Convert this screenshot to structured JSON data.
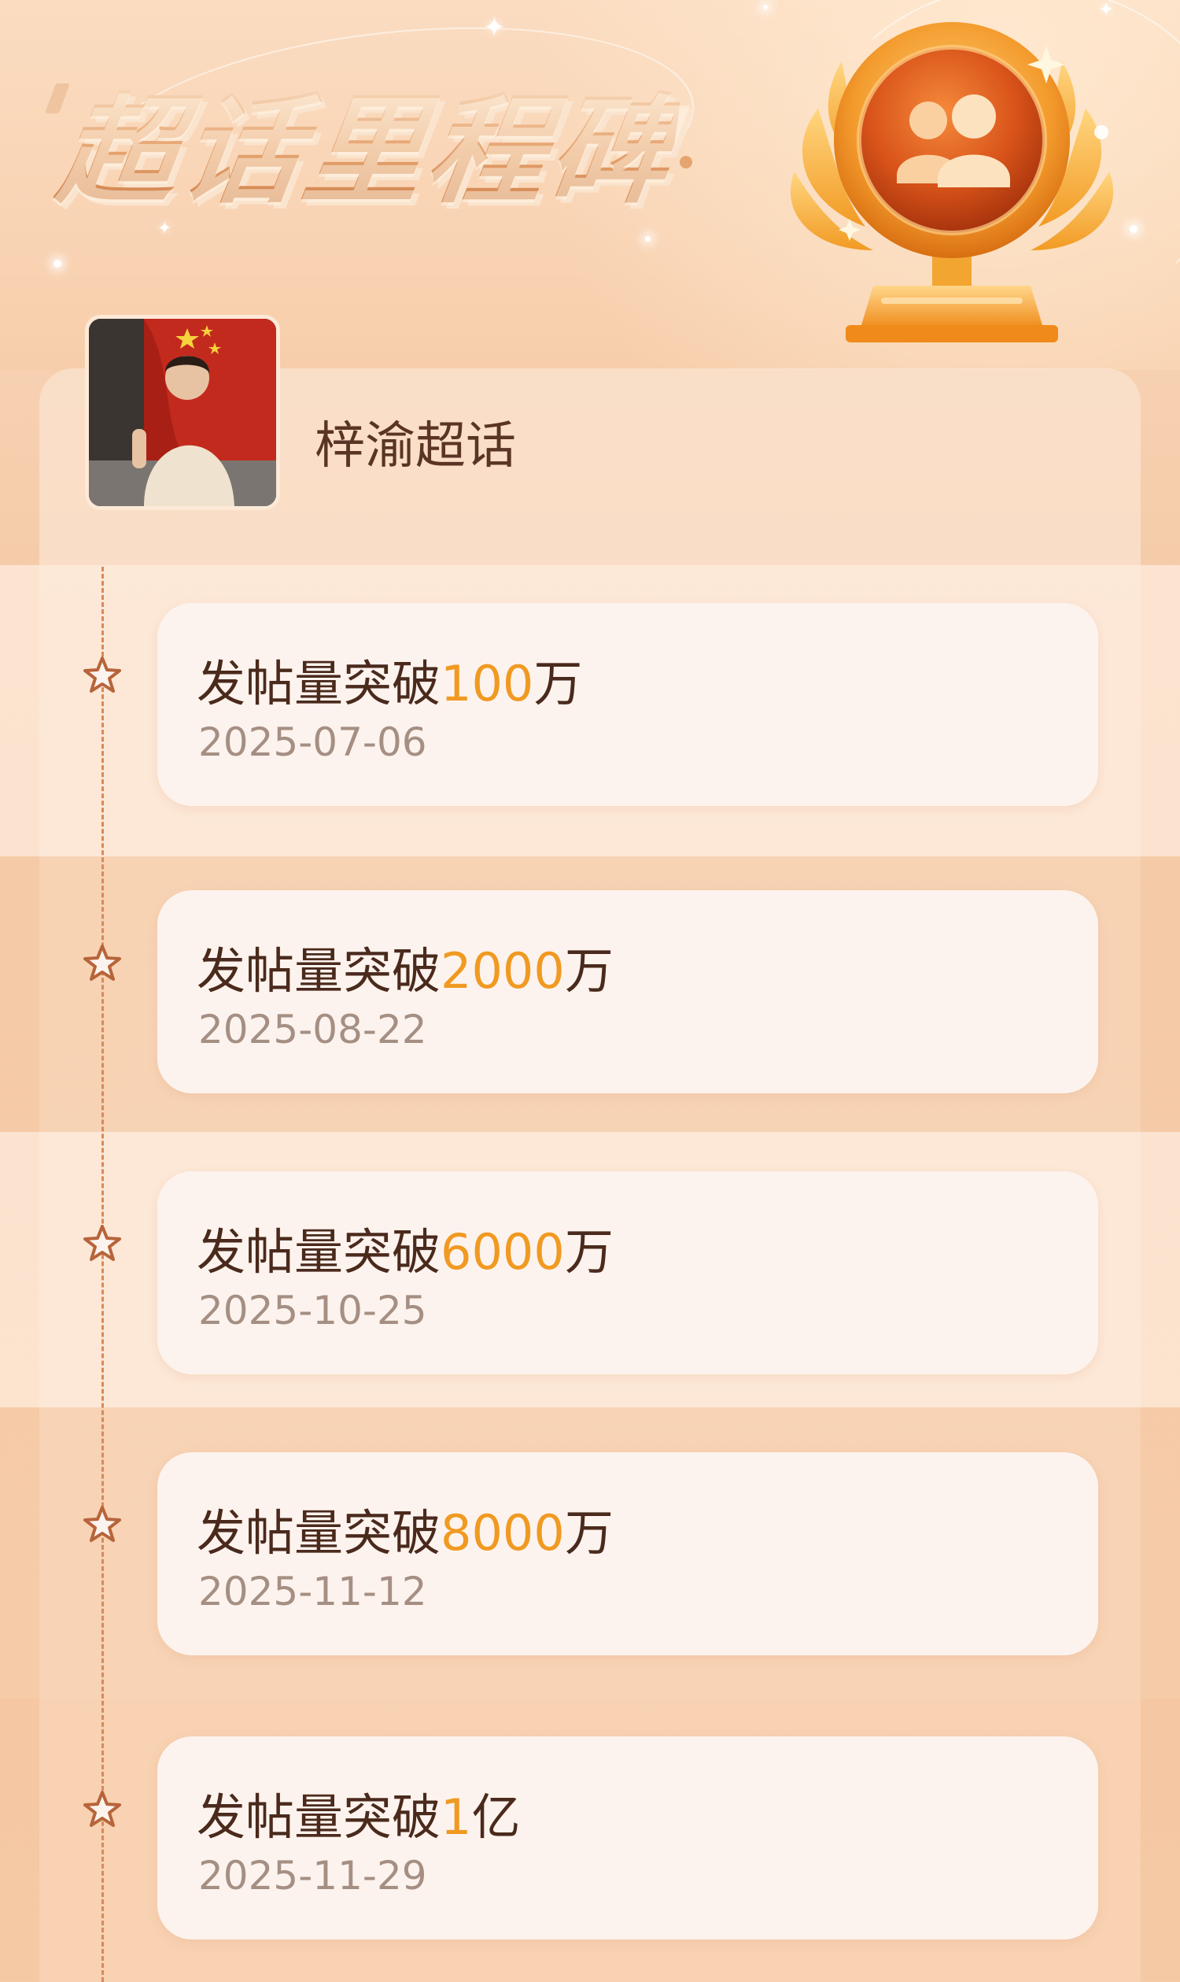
{
  "header": {
    "title": "超话里程碑",
    "trophy_icon": "community-trophy-icon"
  },
  "community": {
    "name": "梓渝超话",
    "avatar_icon": "community-avatar"
  },
  "milestones": [
    {
      "prefix": "发帖量突破",
      "number": "100",
      "suffix": "万",
      "date": "2025-07-06"
    },
    {
      "prefix": "发帖量突破",
      "number": "2000",
      "suffix": "万",
      "date": "2025-08-22"
    },
    {
      "prefix": "发帖量突破",
      "number": "6000",
      "suffix": "万",
      "date": "2025-10-25"
    },
    {
      "prefix": "发帖量突破",
      "number": "8000",
      "suffix": "万",
      "date": "2025-11-12"
    },
    {
      "prefix": "发帖量突破",
      "number": "1",
      "suffix": "亿",
      "date": "2025-11-29"
    }
  ],
  "colors": {
    "accent_number": "#f09a22",
    "title_text": "#4a2a1c",
    "date_text": "#a58f83",
    "timeline": "#d78a5a"
  }
}
